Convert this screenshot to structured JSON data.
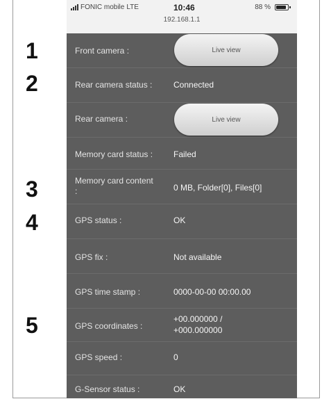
{
  "status_bar": {
    "carrier": "FONIC mobile",
    "network": "LTE",
    "time": "10:46",
    "ip_address": "192.168.1.1",
    "battery": "88 %",
    "battery_level": 0.88
  },
  "callouts": [
    "1",
    "2",
    "3",
    "4",
    "5"
  ],
  "front_camera": {
    "label": "Front camera :",
    "button": "Live view"
  },
  "rear_camera_status": {
    "label": "Rear camera status :",
    "value": "Connected"
  },
  "rear_camera": {
    "label": "Rear camera :",
    "button": "Live view"
  },
  "memory_card_status": {
    "label": "Memory card status :",
    "value": "Failed"
  },
  "memory_card_content": {
    "label": "Memory card content :",
    "value": "0 MB, Folder[0], Files[0]"
  },
  "gps_status": {
    "label": "GPS status :",
    "value": "OK"
  },
  "gps_fix": {
    "label": "GPS fix :",
    "value": "Not available"
  },
  "gps_time_stamp": {
    "label": "GPS time stamp :",
    "value": "0000-00-00 00:00.00"
  },
  "gps_coordinates": {
    "label": "GPS coordinates :",
    "value_line1": "+00.000000 /",
    "value_line2": "+000.000000"
  },
  "gps_speed": {
    "label": "GPS speed :",
    "value": "0"
  },
  "g_sensor_status": {
    "label": "G-Sensor status :",
    "value": "OK"
  }
}
